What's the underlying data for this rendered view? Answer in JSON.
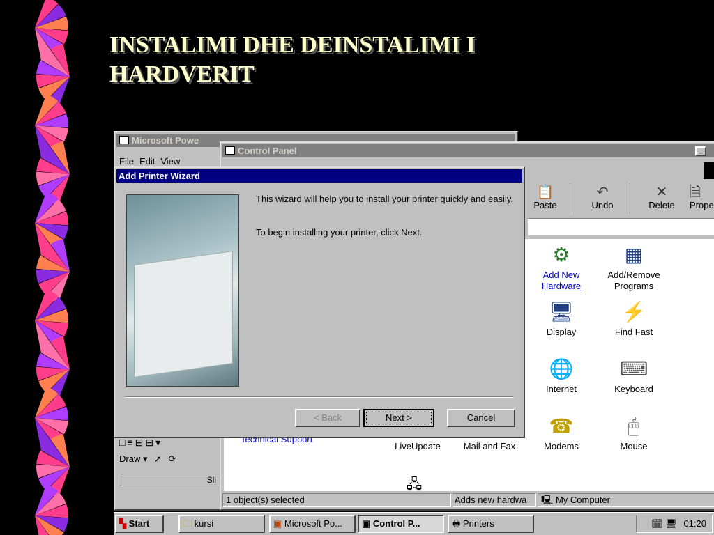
{
  "slide": {
    "title_line1": "INSTALIMI DHE DEINSTALIMI I",
    "title_line2": "HARDVERIT"
  },
  "powerpoint": {
    "title": "Microsoft Powe",
    "menu": [
      "File",
      "Edit",
      "View"
    ],
    "draw_label": "Draw ▾",
    "slide_label": "Sli",
    "status_left": "Technical Support"
  },
  "control_panel": {
    "title": "Control Panel",
    "toolbar": [
      {
        "label": "Paste",
        "icon": "paste-icon"
      },
      {
        "label": "Undo",
        "icon": "undo-icon"
      },
      {
        "label": "Delete",
        "icon": "delete-icon"
      },
      {
        "label": "Prope",
        "icon": "properties-icon"
      }
    ],
    "items": [
      {
        "label": "Add New Hardware",
        "icon": "add-hardware-icon",
        "selected": true
      },
      {
        "label": "Add/Remove Programs",
        "icon": "add-remove-programs-icon"
      },
      {
        "label": "Display",
        "icon": "display-icon"
      },
      {
        "label": "Find Fast",
        "icon": "find-fast-icon"
      },
      {
        "label": "Internet",
        "icon": "internet-icon"
      },
      {
        "label": "Keyboard",
        "icon": "keyboard-icon"
      },
      {
        "label": "LiveUpdate",
        "icon": "liveupdate-icon"
      },
      {
        "label": "Mail and Fax",
        "icon": "mail-fax-icon"
      },
      {
        "label": "Modems",
        "icon": "modems-icon"
      },
      {
        "label": "Mouse",
        "icon": "mouse-icon"
      }
    ],
    "status": {
      "selected": "1 object(s) selected",
      "hint": "Adds new hardwa",
      "location": "My Computer"
    }
  },
  "wizard": {
    "title": "Add Printer Wizard",
    "text1": "This wizard will help you to install your printer quickly and easily.",
    "text2": "To begin installing your printer, click Next.",
    "back_label": "< Back",
    "next_label": "Next >",
    "cancel_label": "Cancel"
  },
  "taskbar": {
    "start_label": "Start",
    "buttons": [
      {
        "label": "kursi",
        "icon": "folder-icon"
      },
      {
        "label": "Microsoft Po...",
        "icon": "powerpoint-icon"
      },
      {
        "label": "Control P...",
        "icon": "control-panel-icon",
        "active": true
      },
      {
        "label": "Printers",
        "icon": "printers-icon"
      }
    ],
    "clock": "01:20"
  }
}
